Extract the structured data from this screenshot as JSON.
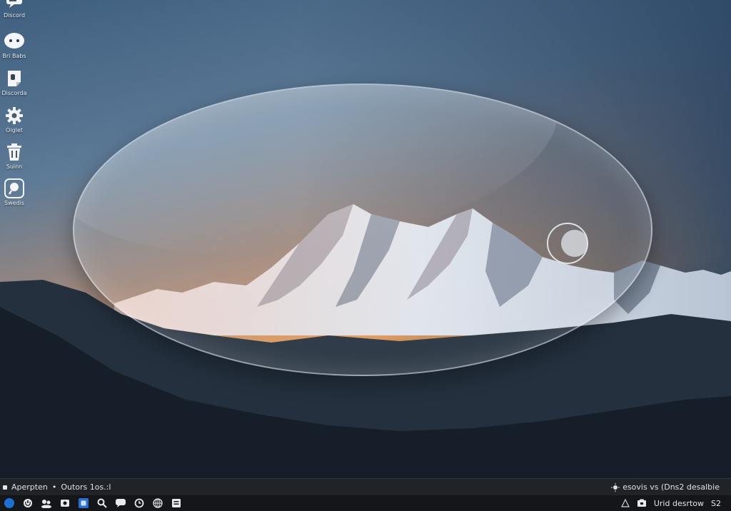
{
  "desktop": {
    "icons": [
      {
        "name": "chat",
        "label": "Discord",
        "icon": "chat-bubble-icon"
      },
      {
        "name": "messages",
        "label": "Bri Babs",
        "icon": "speech-bubble-icon"
      },
      {
        "name": "notes",
        "label": "Discorda",
        "icon": "sticky-note-icon"
      },
      {
        "name": "settings",
        "label": "Oiglet",
        "icon": "gear-icon"
      },
      {
        "name": "trash",
        "label": "Suinn",
        "icon": "trash-icon"
      },
      {
        "name": "search",
        "label": "Swedis",
        "icon": "search-icon"
      }
    ]
  },
  "infobar": {
    "app_name": "Aperpten",
    "separator": "•",
    "status": "Outors 1os.:l",
    "right_icon": "brightness-icon",
    "right_text": "esovis vs (Dns2 desalbie"
  },
  "taskbar": {
    "apps": [
      {
        "name": "start",
        "icon": "start-orb-icon"
      },
      {
        "name": "power",
        "icon": "power-icon"
      },
      {
        "name": "people",
        "icon": "people-icon"
      },
      {
        "name": "camera",
        "icon": "camera-icon"
      },
      {
        "name": "store",
        "icon": "store-icon"
      },
      {
        "name": "magnify",
        "icon": "magnifier-icon"
      },
      {
        "name": "chat",
        "icon": "chat-icon"
      },
      {
        "name": "timer",
        "icon": "timer-icon"
      },
      {
        "name": "globe",
        "icon": "globe-icon"
      },
      {
        "name": "files",
        "icon": "files-icon"
      }
    ],
    "tray_text": "Urid desrtow",
    "tray_value": "S2"
  },
  "colors": {
    "accent": "#1f6fd1",
    "taskbar_bg": "#141619",
    "infobar_bg": "#202327"
  }
}
